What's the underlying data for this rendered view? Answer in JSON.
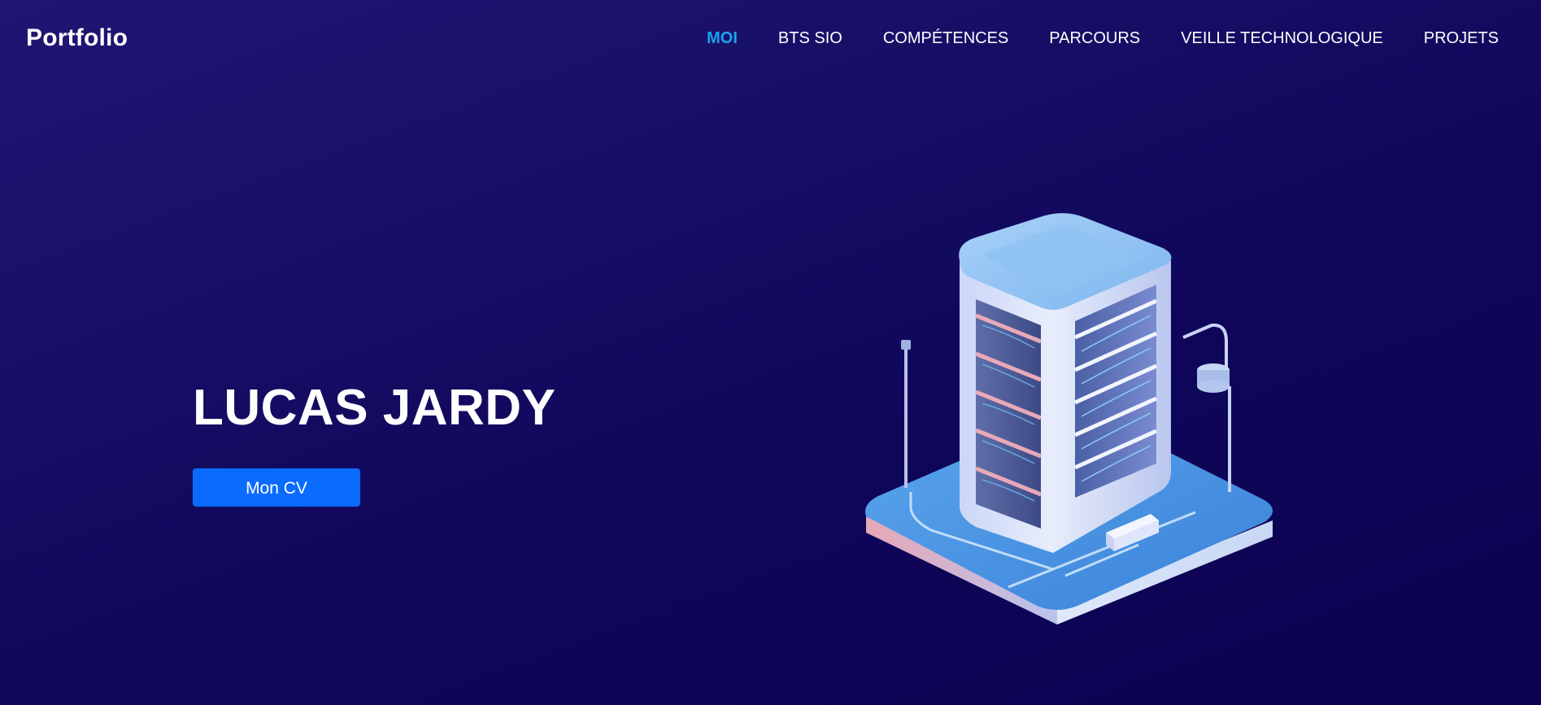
{
  "navbar": {
    "brand": "Portfolio",
    "links": [
      {
        "label": "MOI",
        "active": true
      },
      {
        "label": "BTS SIO",
        "active": false
      },
      {
        "label": "COMPÉTENCES",
        "active": false
      },
      {
        "label": "PARCOURS",
        "active": false
      },
      {
        "label": "VEILLE TECHNOLOGIQUE",
        "active": false
      },
      {
        "label": "PROJETS",
        "active": false
      }
    ]
  },
  "hero": {
    "name": "LUCAS JARDY",
    "cv_button": "Mon CV"
  },
  "illustration": {
    "icon": "server-tower-icon"
  },
  "colors": {
    "accent": "#1aa3ef",
    "button": "#0a6cff",
    "background": "#130a5f"
  }
}
